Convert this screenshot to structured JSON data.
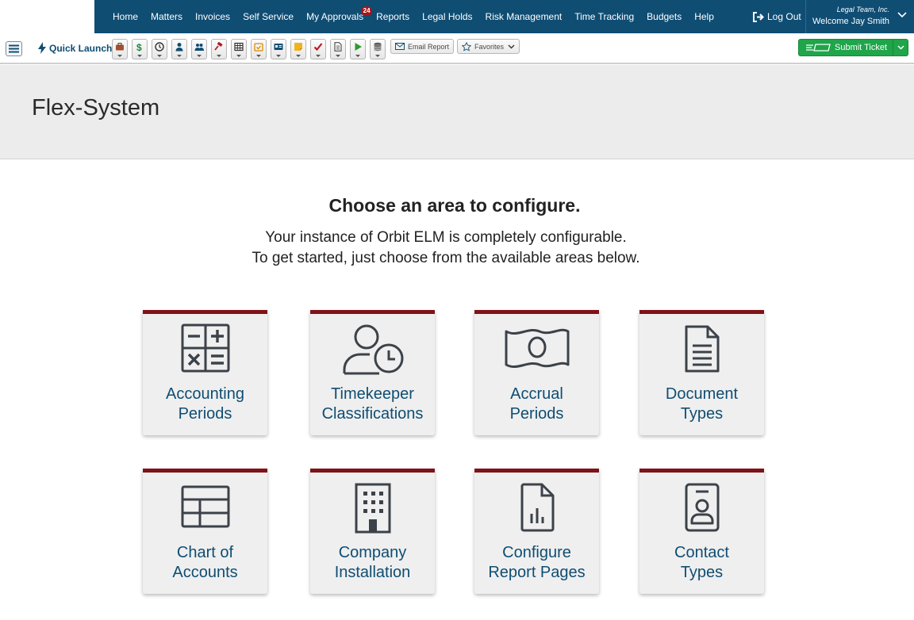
{
  "nav": {
    "items": [
      {
        "label": "Home"
      },
      {
        "label": "Matters"
      },
      {
        "label": "Invoices"
      },
      {
        "label": "Self Service"
      },
      {
        "label": "My Approvals",
        "badge": "24"
      },
      {
        "label": "Reports"
      },
      {
        "label": "Legal Holds"
      },
      {
        "label": "Risk Management"
      },
      {
        "label": "Time Tracking"
      },
      {
        "label": "Budgets"
      },
      {
        "label": "Help"
      }
    ],
    "logout_label": "Log Out",
    "org_name": "Legal Team, Inc.",
    "welcome": "Welcome Jay Smith"
  },
  "toolbar": {
    "quick_launch_label": "Quick Launch",
    "quick_icons": [
      "briefcase-icon",
      "dollar-icon",
      "clock-icon",
      "person-icon",
      "people-icon",
      "gavel-icon",
      "grid-icon",
      "calendar-check-icon",
      "id-card-icon",
      "note-icon",
      "checkmark-icon",
      "document-icon",
      "play-icon",
      "database-icon"
    ],
    "email_report_label": "Email Report",
    "favorites_label": "Favorites",
    "submit_ticket_label": "Submit Ticket"
  },
  "page": {
    "title": "Flex-System",
    "headline": "Choose an area to configure.",
    "subline1": "Your instance of Orbit ELM is completely configurable.",
    "subline2": "To get started, just choose from the available areas below."
  },
  "tiles": [
    {
      "line1": "Accounting",
      "line2": "Periods",
      "icon": "calculator-icon"
    },
    {
      "line1": "Timekeeper",
      "line2": "Classifications",
      "icon": "person-clock-icon"
    },
    {
      "line1": "Accrual",
      "line2": "Periods",
      "icon": "banknote-icon"
    },
    {
      "line1": "Document",
      "line2": "Types",
      "icon": "document-icon"
    },
    {
      "line1": "Chart of",
      "line2": "Accounts",
      "icon": "table-icon"
    },
    {
      "line1": "Company",
      "line2": "Installation",
      "icon": "building-icon"
    },
    {
      "line1": "Configure",
      "line2": "Report Pages",
      "icon": "report-page-icon"
    },
    {
      "line1": "Contact",
      "line2": "Types",
      "icon": "contact-badge-icon"
    }
  ],
  "colors": {
    "nav_bg": "#0f4d73",
    "tile_accent": "#7e1318",
    "tile_text": "#0f4d73",
    "badge": "#a4151b",
    "submit_green": "#1fa54a"
  }
}
